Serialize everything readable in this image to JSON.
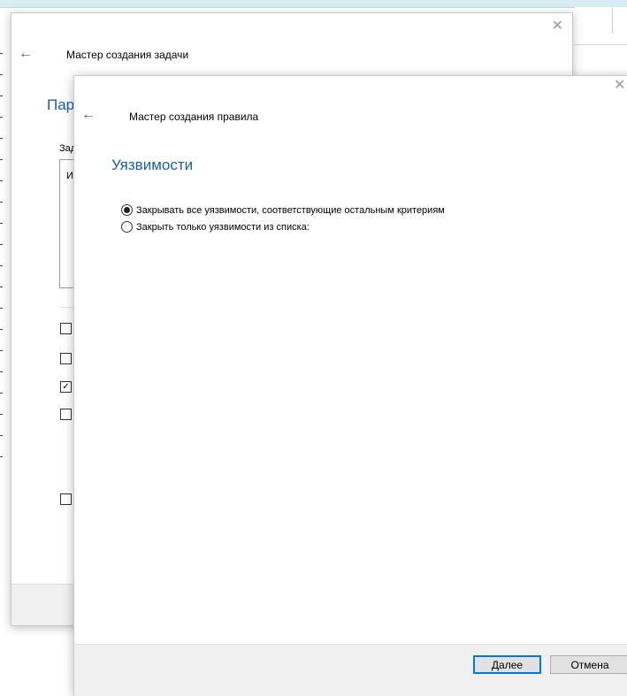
{
  "outer_window": {
    "title": "Мастер создания задачи",
    "section_heading": "Пар",
    "field_label": "Зад",
    "textbox_value": "И",
    "checkboxes": [
      {
        "checked": false
      },
      {
        "checked": false
      },
      {
        "checked": true
      },
      {
        "checked": false
      },
      {
        "checked": false
      }
    ]
  },
  "inner_window": {
    "title": "Мастер создания правила",
    "section_heading": "Уязвимости",
    "radios": [
      {
        "label": "Закрывать все уязвимости, соответствующие остальным критериям",
        "selected": true
      },
      {
        "label": "Закрыть только уязвимости из списка:",
        "selected": false
      }
    ],
    "buttons": {
      "next": "Далее",
      "cancel": "Отмена"
    }
  },
  "icons": {
    "back": "arrow-left-icon",
    "close": "close-icon",
    "check": "checkmark-icon"
  },
  "glyphs": {
    "back": "←",
    "close": "✕",
    "check": "✓"
  },
  "colors": {
    "heading": "#1a5ea8",
    "primary_border": "#0078d7",
    "footer_bg": "#f0f0f0"
  }
}
